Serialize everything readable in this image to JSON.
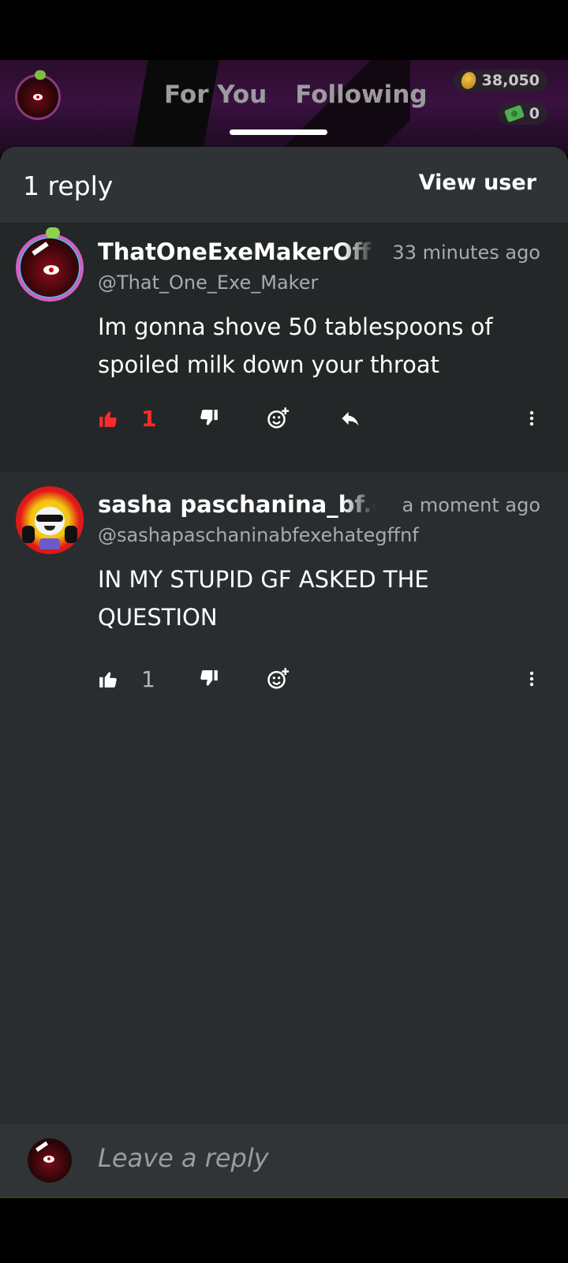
{
  "header": {
    "tabs": [
      {
        "label": "For You",
        "active": false
      },
      {
        "label": "Following",
        "active": true
      }
    ],
    "wallet": {
      "coins": "38,050",
      "cash": "0"
    }
  },
  "sheet": {
    "title": "1 reply",
    "view_user_label": "View user"
  },
  "comments": [
    {
      "display_name": "ThatOneExeMakerOff",
      "time": "33 minutes ago",
      "handle": "@That_One_Exe_Maker",
      "body": "Im gonna shove 50 tablespoons of spoiled milk down your throat",
      "likes": "1",
      "liked": true,
      "accent_color": "#ff2a2a"
    },
    {
      "display_name": "sasha paschanina_bf.exe",
      "time": "a moment ago",
      "handle": "@sashapaschaninabfexehategffnf",
      "body": "IN MY STUPID GF ASKED THE QUESTION",
      "likes": "1",
      "liked": false
    }
  ],
  "reply_input": {
    "placeholder": "Leave a reply"
  }
}
